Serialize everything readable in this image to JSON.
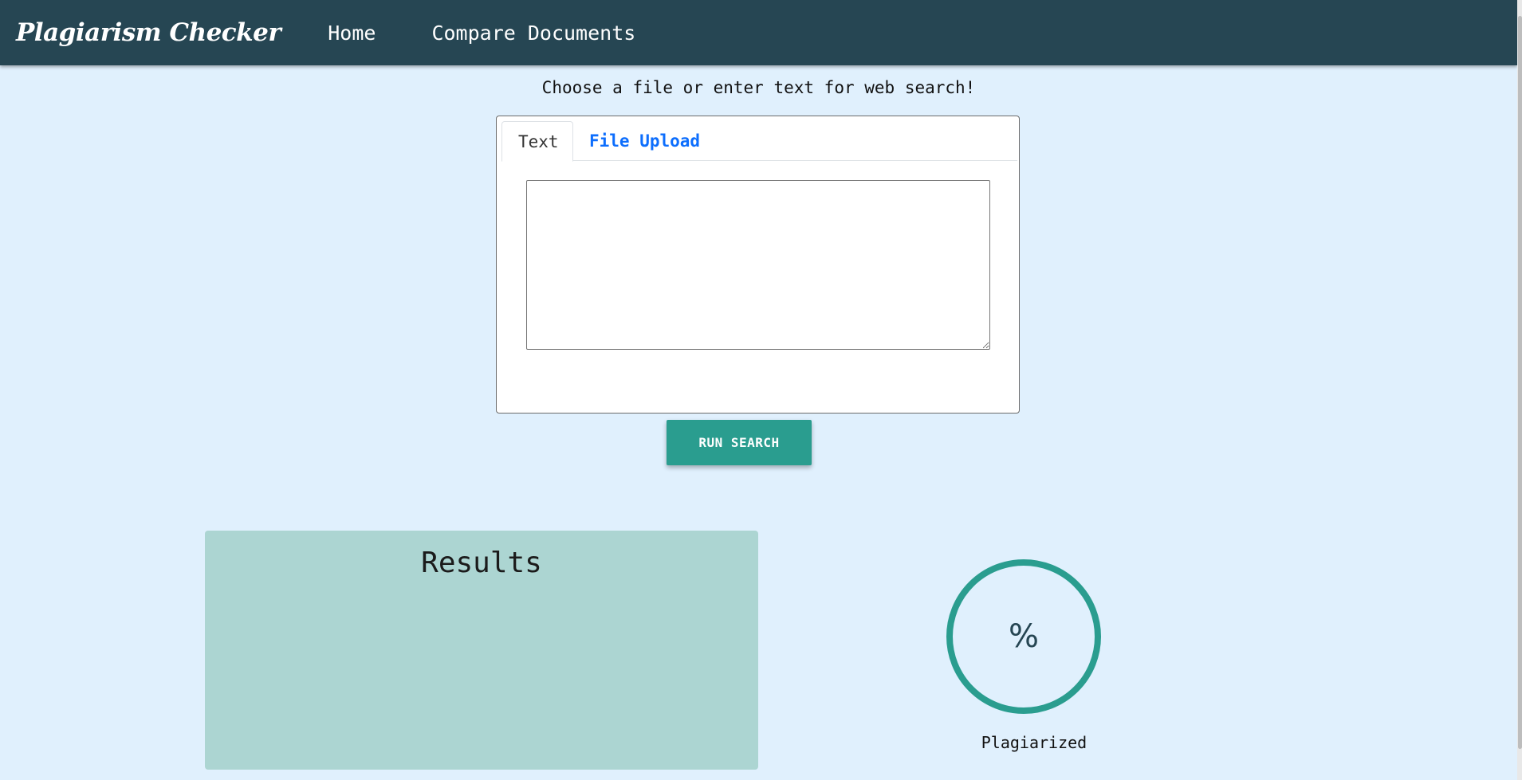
{
  "navbar": {
    "brand": "Plagiarism Checker",
    "links": [
      {
        "label": "Home"
      },
      {
        "label": "Compare Documents"
      }
    ]
  },
  "search": {
    "prompt": "Choose a file or enter text for web search!",
    "tabs": [
      {
        "label": "Text",
        "active": true
      },
      {
        "label": "File Upload",
        "active": false
      }
    ],
    "textarea_value": "",
    "button_label": "RUN SEARCH"
  },
  "results": {
    "title": "Results"
  },
  "gauge": {
    "value": "%",
    "label": "Plagiarized"
  },
  "colors": {
    "navbar": "#264653",
    "accent": "#2a9d8f",
    "page_bg": "#e0f0fd",
    "results_bg": "#acd5d2"
  }
}
